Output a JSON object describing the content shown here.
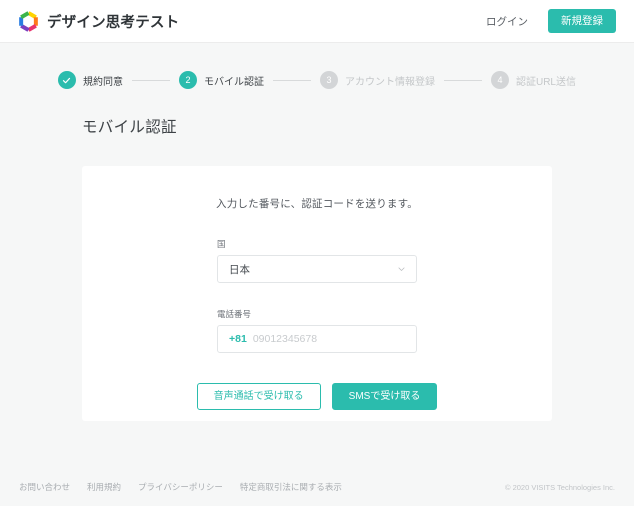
{
  "theme": {
    "accent": "#2bbcad",
    "page_bg": "#f6f7f7",
    "card_bg": "#ffffff",
    "muted": "#c4c7c9"
  },
  "header": {
    "logo_icon": "hexagon-ring-logo-icon",
    "brand_name": "デザイン思考テスト",
    "login_label": "ログイン",
    "signup_label": "新規登録"
  },
  "stepper": {
    "steps": [
      {
        "marker": "✓",
        "label": "規約同意",
        "state": "done"
      },
      {
        "marker": "2",
        "label": "モバイル認証",
        "state": "active"
      },
      {
        "marker": "3",
        "label": "アカウント情報登録",
        "state": "todo"
      },
      {
        "marker": "4",
        "label": "認証URL送信",
        "state": "todo"
      }
    ]
  },
  "main": {
    "page_title": "モバイル認証",
    "card": {
      "intro": "入力した番号に、認証コードを送ります。",
      "country_field": {
        "label": "国",
        "value": "日本",
        "chevron_icon": "chevron-down-icon"
      },
      "phone_field": {
        "label": "電話番号",
        "prefix": "+81",
        "value": "",
        "placeholder": "09012345678"
      },
      "voice_button_label": "音声通話で受け取る",
      "sms_button_label": "SMSで受け取る"
    }
  },
  "footer": {
    "links": [
      "お問い合わせ",
      "利用規約",
      "プライバシーポリシー",
      "特定商取引法に関する表示"
    ],
    "copyright": "© 2020 VISITS Technologies Inc."
  }
}
